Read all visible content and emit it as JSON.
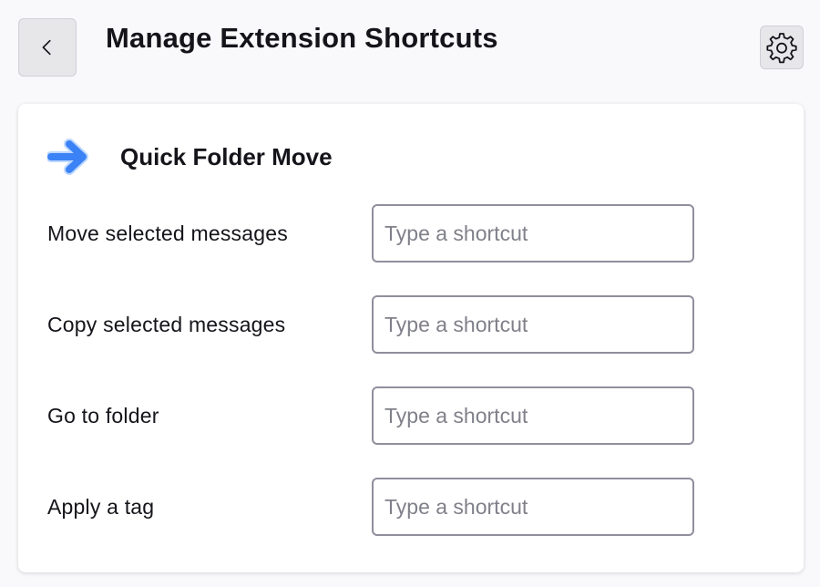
{
  "header": {
    "back_icon": "chevron-left-icon",
    "title": "Manage Extension Shortcuts",
    "settings_icon": "gear-icon"
  },
  "extension": {
    "name": "Quick Folder Move",
    "icon": "blue-arrow-right-icon",
    "icon_color": "#3b82f6"
  },
  "shortcuts": [
    {
      "label": "Move selected messages",
      "value": "",
      "placeholder": "Type a shortcut"
    },
    {
      "label": "Copy selected messages",
      "value": "",
      "placeholder": "Type a shortcut"
    },
    {
      "label": "Go to folder",
      "value": "",
      "placeholder": "Type a shortcut"
    },
    {
      "label": "Apply a tag",
      "value": "",
      "placeholder": "Type a shortcut"
    }
  ],
  "colors": {
    "background": "#f9f9fb",
    "card": "#ffffff",
    "text": "#15141a",
    "placeholder": "#80808a",
    "input_border": "#8f8f9d",
    "button_bg": "#e7e7ea"
  }
}
